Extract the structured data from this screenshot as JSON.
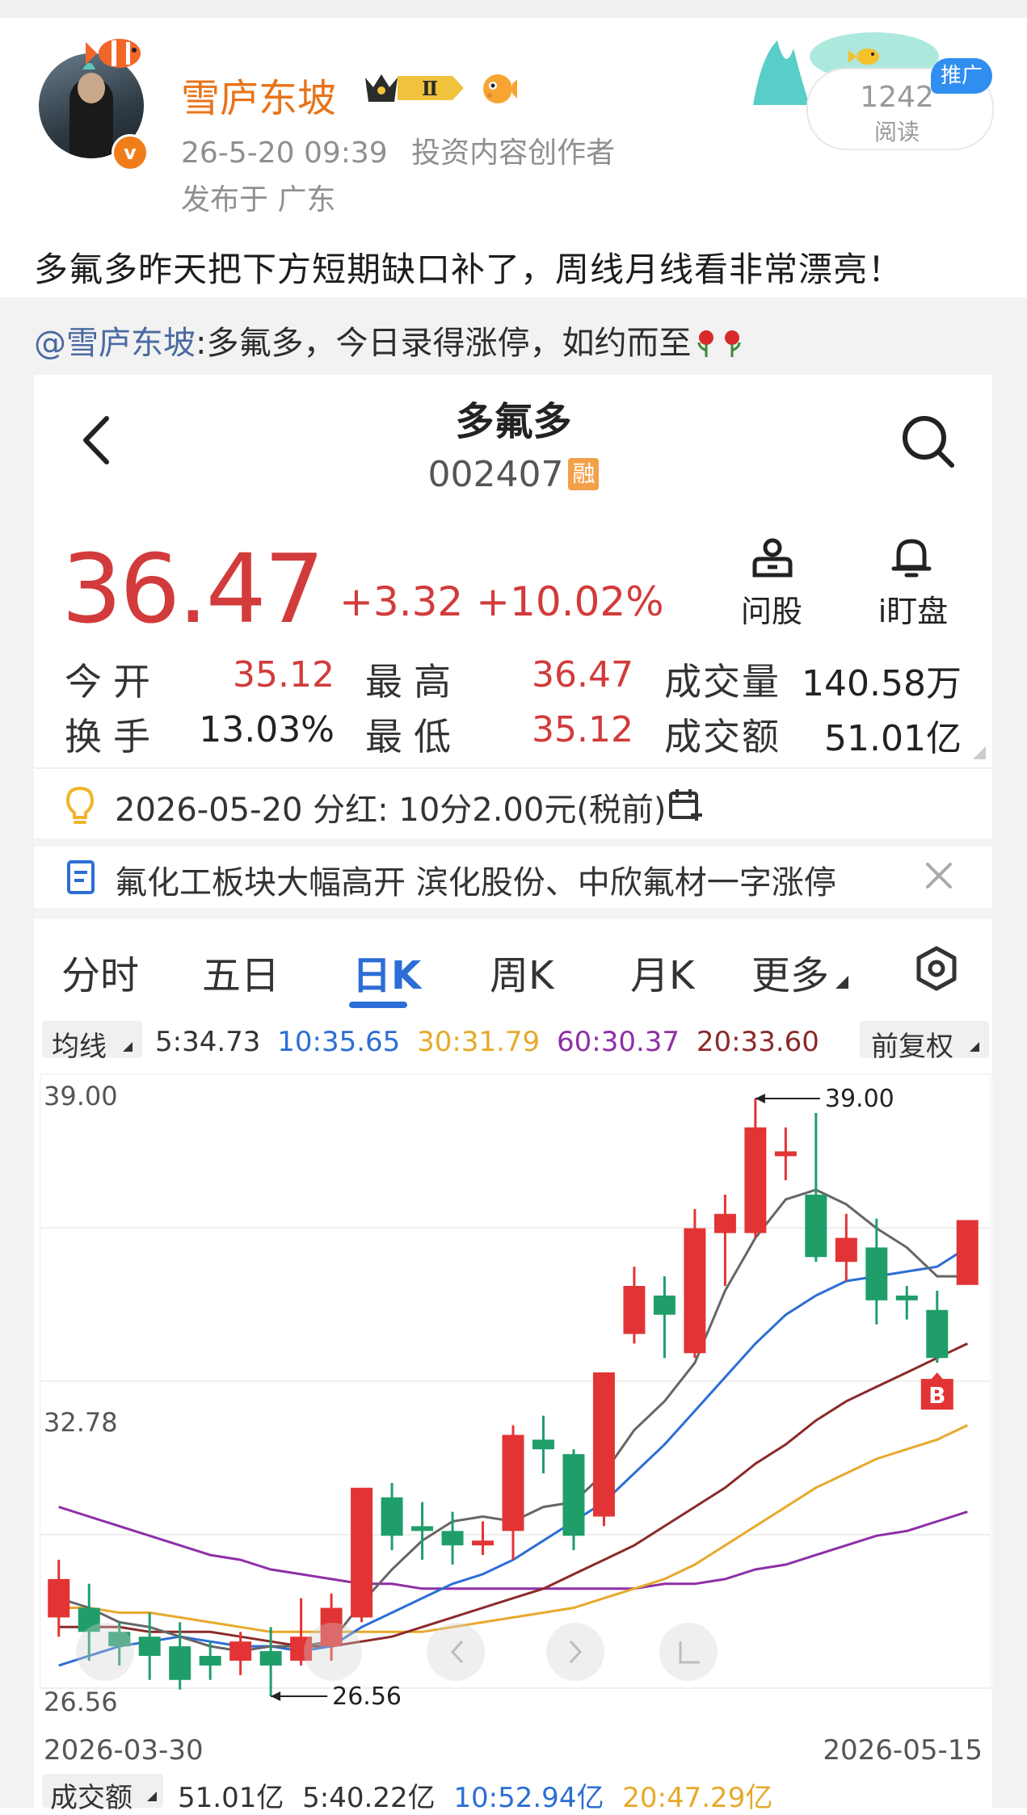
{
  "post": {
    "username": "雪庐东坡",
    "level_badge": "Ⅱ",
    "time": "26-5-20 09:39",
    "role": "投资内容创作者",
    "location": "发布于 广东",
    "promo_tag": "推广",
    "read_count": "1242",
    "read_label": "阅读",
    "text": "多氟多昨天把下方短期缺口补了，周线月线看非常漂亮！",
    "verified": "v"
  },
  "repost": {
    "at_user": "@雪庐东坡",
    "text": ":多氟多，今日录得涨停，如约而至"
  },
  "stock": {
    "name": "多氟多",
    "code": "002407",
    "margin_tag": "融",
    "price": "36.47",
    "change": "+3.32",
    "change_pct": "+10.02%",
    "ask_label": "问股",
    "watch_label": "i盯盘",
    "quote": {
      "open_label": "今开",
      "open": "35.12",
      "high_label": "最高",
      "high": "36.47",
      "vol_label": "成交量",
      "vol": "140.58万",
      "turnover_label": "换手",
      "turnover": "13.03%",
      "low_label": "最低",
      "low": "35.12",
      "amount_label": "成交额",
      "amount": "51.01亿"
    },
    "dividend": "2026-05-20 分红: 10分2.00元(税前)",
    "news": "氟化工板块大幅高开 滨化股份、中欣氟材一字涨停"
  },
  "kline": {
    "tabs": [
      "分时",
      "五日",
      "日K",
      "周K",
      "月K",
      "更多"
    ],
    "active_tab": "日K",
    "ma_label": "均线",
    "ma": [
      {
        "text": "5:34.73",
        "color": "#333333"
      },
      {
        "text": "10:35.65",
        "color": "#2c6ed5"
      },
      {
        "text": "30:31.79",
        "color": "#e7a92b"
      },
      {
        "text": "60:30.37",
        "color": "#8e2fa6"
      },
      {
        "text": "20:33.60",
        "color": "#8b2a2a"
      }
    ],
    "adjust_label": "前复权",
    "vol_label": "成交额",
    "vol_ma": [
      {
        "text": "51.01亿",
        "color": "#333333"
      },
      {
        "text": "5:40.22亿",
        "color": "#333333"
      },
      {
        "text": "10:52.94亿",
        "color": "#2c6ed5"
      },
      {
        "text": "20:47.29亿",
        "color": "#e7a92b"
      }
    ]
  },
  "chart_data": {
    "type": "candlestick",
    "y_top_label": "39.00",
    "y_mid_label": "32.78",
    "y_bottom_label": "26.56",
    "ylim": [
      26.56,
      39.0
    ],
    "x_start": "2026-03-30",
    "x_end": "2026-05-15",
    "max_marker": "39.00",
    "min_marker": "26.56",
    "b_marker": "B",
    "up_color": "#e23434",
    "down_color": "#1f9e6a",
    "candles": [
      {
        "o": 28.2,
        "c": 29.0,
        "h": 29.4,
        "l": 27.8
      },
      {
        "o": 28.4,
        "c": 27.9,
        "h": 28.9,
        "l": 27.3
      },
      {
        "o": 27.9,
        "c": 27.6,
        "h": 28.1,
        "l": 27.2
      },
      {
        "o": 27.8,
        "c": 27.4,
        "h": 28.3,
        "l": 26.9
      },
      {
        "o": 27.6,
        "c": 26.9,
        "h": 28.1,
        "l": 26.7
      },
      {
        "o": 27.4,
        "c": 27.2,
        "h": 27.7,
        "l": 26.9
      },
      {
        "o": 27.3,
        "c": 27.7,
        "h": 27.9,
        "l": 27.0
      },
      {
        "o": 27.5,
        "c": 27.2,
        "h": 28.0,
        "l": 26.56
      },
      {
        "o": 27.3,
        "c": 27.8,
        "h": 28.6,
        "l": 27.2
      },
      {
        "o": 27.6,
        "c": 28.4,
        "h": 28.7,
        "l": 27.3
      },
      {
        "o": 28.2,
        "c": 30.9,
        "h": 30.9,
        "l": 28.1
      },
      {
        "o": 30.7,
        "c": 29.9,
        "h": 31.0,
        "l": 29.6
      },
      {
        "o": 30.1,
        "c": 30.0,
        "h": 30.6,
        "l": 29.4
      },
      {
        "o": 30.0,
        "c": 29.7,
        "h": 30.4,
        "l": 29.3
      },
      {
        "o": 29.7,
        "c": 29.8,
        "h": 30.2,
        "l": 29.5
      },
      {
        "o": 30.0,
        "c": 32.0,
        "h": 32.2,
        "l": 29.4
      },
      {
        "o": 31.9,
        "c": 31.7,
        "h": 32.4,
        "l": 31.2
      },
      {
        "o": 31.6,
        "c": 29.9,
        "h": 31.7,
        "l": 29.6
      },
      {
        "o": 30.3,
        "c": 33.3,
        "h": 33.3,
        "l": 30.1
      },
      {
        "o": 34.1,
        "c": 35.1,
        "h": 35.5,
        "l": 33.9
      },
      {
        "o": 34.9,
        "c": 34.5,
        "h": 35.3,
        "l": 33.6
      },
      {
        "o": 33.7,
        "c": 36.3,
        "h": 36.7,
        "l": 33.6
      },
      {
        "o": 36.2,
        "c": 36.6,
        "h": 37.0,
        "l": 35.1
      },
      {
        "o": 36.2,
        "c": 38.4,
        "h": 39.0,
        "l": 36.1
      },
      {
        "o": 37.8,
        "c": 37.9,
        "h": 38.4,
        "l": 37.3
      },
      {
        "o": 37.0,
        "c": 35.7,
        "h": 38.7,
        "l": 35.6
      },
      {
        "o": 35.6,
        "c": 36.1,
        "h": 36.6,
        "l": 35.2
      },
      {
        "o": 35.9,
        "c": 34.8,
        "h": 36.5,
        "l": 34.3
      },
      {
        "o": 34.9,
        "c": 34.8,
        "h": 35.1,
        "l": 34.4
      },
      {
        "o": 34.6,
        "c": 33.6,
        "h": 35.0,
        "l": 33.5
      },
      {
        "o": 35.12,
        "c": 36.47,
        "h": 36.47,
        "l": 35.12
      }
    ],
    "ma5": [
      28.6,
      28.4,
      28.1,
      28.0,
      27.8,
      27.6,
      27.5,
      27.6,
      27.6,
      27.7,
      28.5,
      29.2,
      29.8,
      30.2,
      30.3,
      30.2,
      30.5,
      30.6,
      31.2,
      32.1,
      32.7,
      33.5,
      35.0,
      36.1,
      36.9,
      37.1,
      36.8,
      36.3,
      35.9,
      35.3,
      35.3
    ],
    "ma10": [
      27.2,
      27.4,
      27.6,
      27.7,
      27.8,
      27.7,
      27.6,
      27.6,
      27.5,
      27.6,
      28.0,
      28.3,
      28.6,
      28.9,
      29.1,
      29.4,
      29.8,
      30.2,
      30.6,
      31.2,
      31.8,
      32.5,
      33.2,
      33.9,
      34.5,
      34.9,
      35.2,
      35.3,
      35.4,
      35.5,
      35.9
    ],
    "ma20": [
      28.0,
      28.0,
      28.0,
      27.9,
      27.9,
      27.9,
      27.8,
      27.7,
      27.6,
      27.6,
      27.7,
      27.8,
      28.0,
      28.2,
      28.4,
      28.6,
      28.8,
      29.1,
      29.4,
      29.7,
      30.1,
      30.5,
      30.9,
      31.4,
      31.8,
      32.3,
      32.7,
      33.0,
      33.3,
      33.6,
      33.9
    ],
    "ma30": [
      28.4,
      28.4,
      28.3,
      28.3,
      28.2,
      28.1,
      28.0,
      27.9,
      27.9,
      27.9,
      27.9,
      27.9,
      27.9,
      28.0,
      28.1,
      28.2,
      28.3,
      28.4,
      28.6,
      28.8,
      29.0,
      29.3,
      29.7,
      30.1,
      30.5,
      30.9,
      31.2,
      31.5,
      31.7,
      31.9,
      32.2
    ],
    "ma60": [
      30.5,
      30.3,
      30.1,
      29.9,
      29.7,
      29.5,
      29.4,
      29.2,
      29.1,
      29.0,
      28.9,
      28.9,
      28.8,
      28.8,
      28.8,
      28.8,
      28.8,
      28.8,
      28.8,
      28.8,
      28.9,
      28.9,
      29.0,
      29.2,
      29.3,
      29.5,
      29.7,
      29.9,
      30.0,
      30.2,
      30.4
    ]
  }
}
